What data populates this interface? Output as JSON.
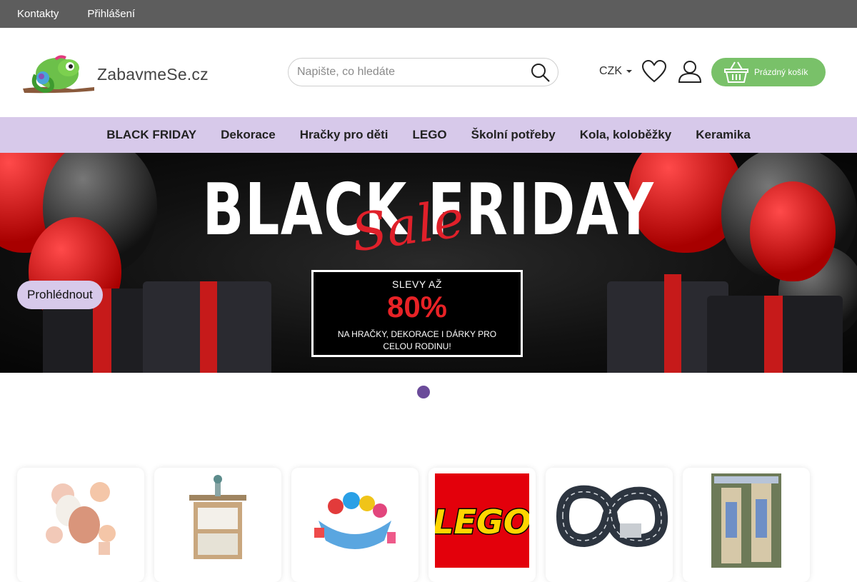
{
  "topbar": {
    "links": [
      "Kontakty",
      "Přihlášení"
    ]
  },
  "header": {
    "logo_text": "ZabavmeSe.cz",
    "search_placeholder": "Napište, co hledáte",
    "currency": "CZK",
    "cart_label": "Prázdný košík",
    "colors": {
      "cart": "#79c169",
      "topbar": "#5d5d5d"
    }
  },
  "nav": {
    "items": [
      "BLACK FRIDAY",
      "Dekorace",
      "Hračky pro děti",
      "LEGO",
      "Školní potřeby",
      "Kola, koloběžky",
      "Keramika"
    ],
    "background": "#d7c9ea"
  },
  "hero": {
    "title": "BLACK FRIDAY",
    "script": "Sale",
    "offer_line1": "SLEVY AŽ",
    "offer_percent": "80%",
    "offer_line3": "NA HRAČKY, DEKORACE I DÁRKY PRO CELOU RODINU!",
    "cta": "Prohlédnout",
    "slide_count": 1,
    "active_slide": 1
  },
  "categories": {
    "icons": [
      "balloons-icon",
      "dollhouse-icon",
      "balance-toy-icon",
      "lego-logo-icon",
      "race-track-icon",
      "wind-chime-icon"
    ]
  }
}
